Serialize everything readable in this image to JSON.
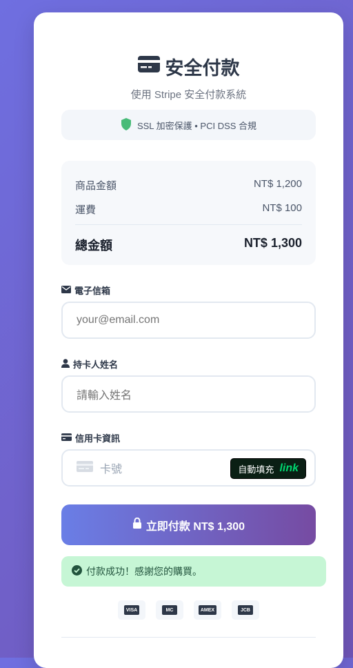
{
  "header": {
    "title": "安全付款",
    "subtitle": "使用 Stripe 安全付款系統"
  },
  "security_notice": "SSL 加密保護 • PCI DSS 合規",
  "summary": {
    "items": [
      {
        "label": "商品金額",
        "value": "NT$ 1,200"
      },
      {
        "label": "運費",
        "value": "NT$ 100"
      }
    ],
    "total_label": "總金額",
    "total_value": "NT$ 1,300"
  },
  "form": {
    "email_label": "電子信箱",
    "email_placeholder": "your@email.com",
    "name_label": "持卡人姓名",
    "name_placeholder": "請輸入姓名",
    "card_label": "信用卡資訊",
    "card_placeholder": "卡號",
    "autofill_label": "自動填充",
    "autofill_brand": "link"
  },
  "pay_button": "立即付款 NT$ 1,300",
  "success_message": "付款成功！感謝您的購買。",
  "card_brands": [
    {
      "name": "VISA",
      "icon": "visa-icon"
    },
    {
      "name": "MC",
      "icon": "mastercard-icon"
    },
    {
      "name": "AMEX",
      "icon": "amex-icon"
    },
    {
      "name": "JCB",
      "icon": "jcb-icon"
    }
  ],
  "colors": {
    "accent_start": "#667eea",
    "accent_end": "#764ba2",
    "success_bg": "#c6f6d5",
    "success_text": "#22543d",
    "link_green": "#00d66f"
  }
}
